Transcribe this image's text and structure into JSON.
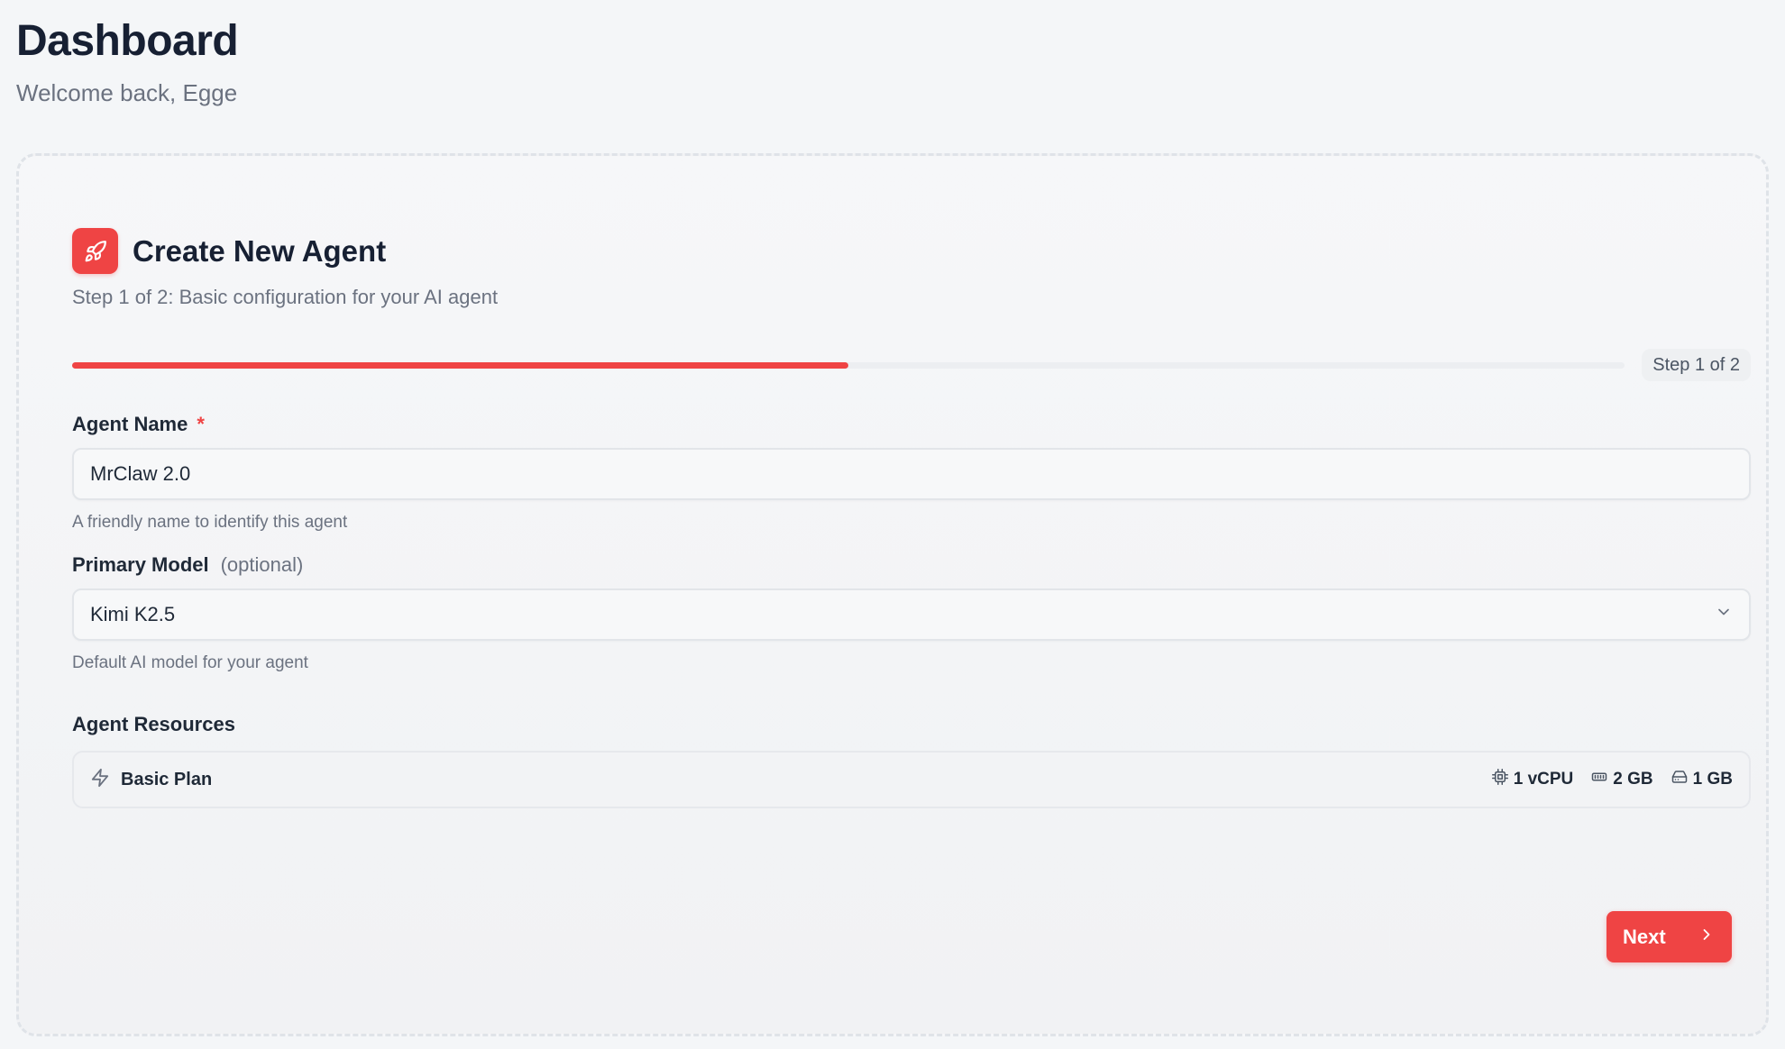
{
  "header": {
    "title": "Dashboard",
    "subtitle": "Welcome back, Egge"
  },
  "wizard": {
    "title": "Create New Agent",
    "subtitle": "Step 1 of 2: Basic configuration for your AI agent",
    "step_indicator": "Step 1 of 2",
    "progress_fraction": 0.5,
    "accent_color": "#ef4444",
    "icon": "rocket-icon"
  },
  "fields": {
    "agent_name": {
      "label": "Agent Name",
      "required_mark": "*",
      "value": "MrClaw 2.0",
      "helper": "A friendly name to identify this agent"
    },
    "primary_model": {
      "label": "Primary Model",
      "optional_note": "(optional)",
      "value": "Kimi K2.5",
      "helper": "Default AI model for your agent",
      "icon": "chevron-down-icon"
    }
  },
  "resources": {
    "label": "Agent Resources",
    "plan_name": "Basic Plan",
    "plan_icon": "lightning-icon",
    "cpu": "1 vCPU",
    "memory": "2 GB",
    "storage": "1 GB"
  },
  "actions": {
    "next_label": "Next"
  }
}
